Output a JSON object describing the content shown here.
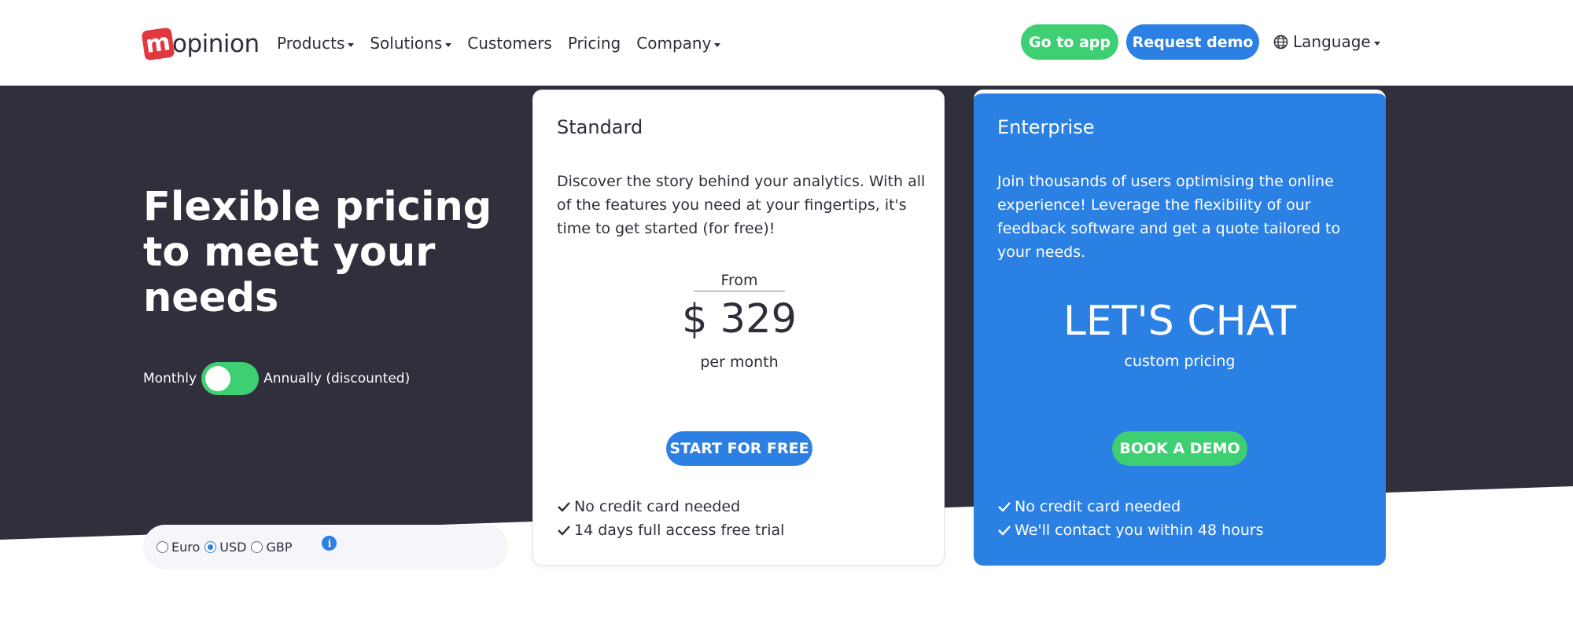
{
  "header": {
    "logo": {
      "mark": "m",
      "text": "opinion"
    },
    "nav": [
      {
        "label": "Products",
        "has_dropdown": true
      },
      {
        "label": "Solutions",
        "has_dropdown": true
      },
      {
        "label": "Customers",
        "has_dropdown": false
      },
      {
        "label": "Pricing",
        "has_dropdown": false
      },
      {
        "label": "Company",
        "has_dropdown": true
      }
    ],
    "go_to_app": "Go to app",
    "request_demo": "Request demo",
    "language": "Language"
  },
  "hero": {
    "title": "Flexible pricing to meet your needs",
    "billing": {
      "monthly_label": "Monthly",
      "annual_label": "Annually (discounted)",
      "annual_selected": true
    },
    "currency": {
      "options": [
        "Euro",
        "USD",
        "GBP"
      ],
      "selected": "USD",
      "info_icon": "i"
    }
  },
  "plans": {
    "standard": {
      "name": "Standard",
      "description": "Discover the story behind your analytics. With all of the features you need at your fingertips, it's time to get started (for free)!",
      "from_label": "From",
      "price": "$ 329",
      "period": "per month",
      "cta": "START FOR FREE",
      "features": [
        "No credit card needed",
        "14 days full access free trial"
      ]
    },
    "enterprise": {
      "name": "Enterprise",
      "description": "Join thousands of users optimising the online experience! Leverage the flexibility of our feedback software and get a quote tailored to your needs.",
      "headline": "LET'S CHAT",
      "subline": "custom pricing",
      "cta": "BOOK A DEMO",
      "features": [
        "No credit card needed",
        "We'll contact you within 48 hours"
      ]
    }
  },
  "colors": {
    "brand_red": "#e0383e",
    "accent_blue": "#2c7fe3",
    "accent_green": "#3ecf73",
    "hero_dark": "#30303d",
    "text_dark": "#2e2e3a"
  }
}
